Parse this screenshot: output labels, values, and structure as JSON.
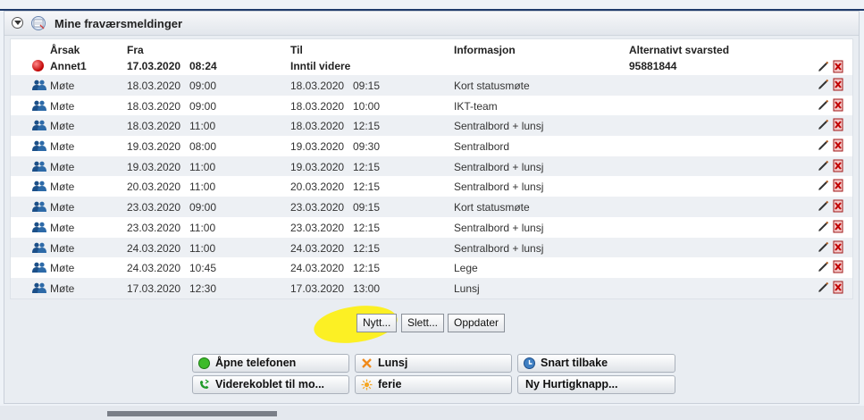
{
  "panel": {
    "title": "Mine fraværsmeldinger"
  },
  "columns": {
    "reason": "Årsak",
    "from": "Fra",
    "to": "Til",
    "info": "Informasjon",
    "alt": "Alternativt svarsted"
  },
  "current": {
    "reason": "Annet1",
    "from_date": "17.03.2020",
    "from_time": "08:24",
    "to": "Inntil videre",
    "info": "",
    "alt": "95881844"
  },
  "rows": [
    {
      "reason": "Møte",
      "from_date": "18.03.2020",
      "from_time": "09:00",
      "to_date": "18.03.2020",
      "to_time": "09:15",
      "info": "Kort statusmøte"
    },
    {
      "reason": "Møte",
      "from_date": "18.03.2020",
      "from_time": "09:00",
      "to_date": "18.03.2020",
      "to_time": "10:00",
      "info": "IKT-team"
    },
    {
      "reason": "Møte",
      "from_date": "18.03.2020",
      "from_time": "11:00",
      "to_date": "18.03.2020",
      "to_time": "12:15",
      "info": "Sentralbord + lunsj"
    },
    {
      "reason": "Møte",
      "from_date": "19.03.2020",
      "from_time": "08:00",
      "to_date": "19.03.2020",
      "to_time": "09:30",
      "info": "Sentralbord"
    },
    {
      "reason": "Møte",
      "from_date": "19.03.2020",
      "from_time": "11:00",
      "to_date": "19.03.2020",
      "to_time": "12:15",
      "info": "Sentralbord + lunsj"
    },
    {
      "reason": "Møte",
      "from_date": "20.03.2020",
      "from_time": "11:00",
      "to_date": "20.03.2020",
      "to_time": "12:15",
      "info": "Sentralbord + lunsj"
    },
    {
      "reason": "Møte",
      "from_date": "23.03.2020",
      "from_time": "09:00",
      "to_date": "23.03.2020",
      "to_time": "09:15",
      "info": "Kort statusmøte"
    },
    {
      "reason": "Møte",
      "from_date": "23.03.2020",
      "from_time": "11:00",
      "to_date": "23.03.2020",
      "to_time": "12:15",
      "info": "Sentralbord + lunsj"
    },
    {
      "reason": "Møte",
      "from_date": "24.03.2020",
      "from_time": "11:00",
      "to_date": "24.03.2020",
      "to_time": "12:15",
      "info": "Sentralbord + lunsj"
    },
    {
      "reason": "Møte",
      "from_date": "24.03.2020",
      "from_time": "10:45",
      "to_date": "24.03.2020",
      "to_time": "12:15",
      "info": "Lege"
    },
    {
      "reason": "Møte",
      "from_date": "17.03.2020",
      "from_time": "12:30",
      "to_date": "17.03.2020",
      "to_time": "13:00",
      "info": "Lunsj"
    }
  ],
  "actions": {
    "new": "Nytt...",
    "delete": "Slett...",
    "refresh": "Oppdater"
  },
  "quick": [
    {
      "label": "Åpne telefonen",
      "icon": "green-circle-icon"
    },
    {
      "label": "Lunsj",
      "icon": "orange-x-icon"
    },
    {
      "label": "Snart tilbake",
      "icon": "clock-icon"
    },
    {
      "label": "Viderekoblet til mo...",
      "icon": "phone-forward-icon"
    },
    {
      "label": "ferie",
      "icon": "sun-icon"
    },
    {
      "label": "Ny Hurtigknapp...",
      "icon": ""
    }
  ],
  "colors": {
    "accent": "#1e3a6b",
    "highlight": "#ffee00",
    "status_red": "#c00000"
  }
}
